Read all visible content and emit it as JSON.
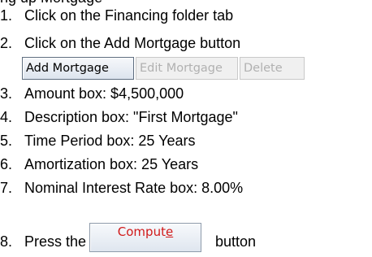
{
  "header_fragment": "ng up Mortgage",
  "steps": [
    {
      "num": "1.",
      "text": "Click on the Financing folder tab"
    },
    {
      "num": "2.",
      "text": "Click on the Add Mortgage button"
    },
    {
      "num": "3.",
      "text": "Amount box: $4,500,000"
    },
    {
      "num": "4.",
      "text": "Description box: \"First Mortgage\""
    },
    {
      "num": "5.",
      "text": "Time Period box: 25 Years"
    },
    {
      "num": "6.",
      "text": "Amortization box: 25 Years"
    },
    {
      "num": "7.",
      "text": "Nominal Interest Rate box: 8.00%"
    },
    {
      "num": "8.",
      "text_before": "Press the",
      "text_after": "button"
    }
  ],
  "toolbar": {
    "add_label": "Add Mortgage",
    "edit_label": "Edit Mortgage",
    "delete_label": "Delete"
  },
  "compute": {
    "label_main": "Comput",
    "label_mnemonic": "e"
  },
  "colors": {
    "compute_text": "#d11a1a",
    "disabled_text": "#b1b1b1"
  }
}
